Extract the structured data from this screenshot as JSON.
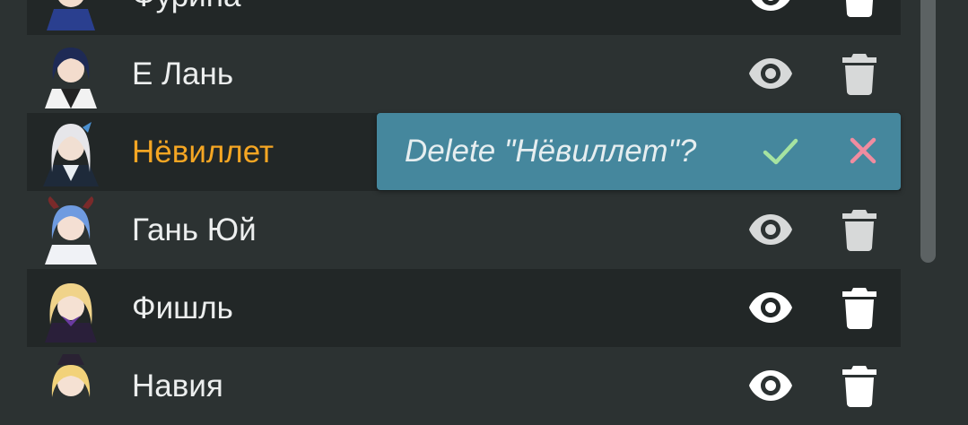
{
  "characters": [
    {
      "name": "Фурина",
      "highlight": false
    },
    {
      "name": "Е Лань",
      "highlight": false
    },
    {
      "name": "Нёвиллет",
      "highlight": true
    },
    {
      "name": "Гань Юй",
      "highlight": false
    },
    {
      "name": "Фишль",
      "highlight": false
    },
    {
      "name": "Навия",
      "highlight": false
    }
  ],
  "icons": {
    "view": "eye-icon",
    "delete": "trash-icon",
    "confirm": "check-icon",
    "cancel": "close-icon"
  },
  "confirm_dialog": {
    "text": "Delete \"Нёвиллет\"?"
  },
  "colors": {
    "background": "#2c3232",
    "row_alt": "#222727",
    "highlight_name": "#f5a623",
    "dialog_bg": "#45879d",
    "check": "#a6e3a1",
    "cancel": "#f08ca0"
  }
}
